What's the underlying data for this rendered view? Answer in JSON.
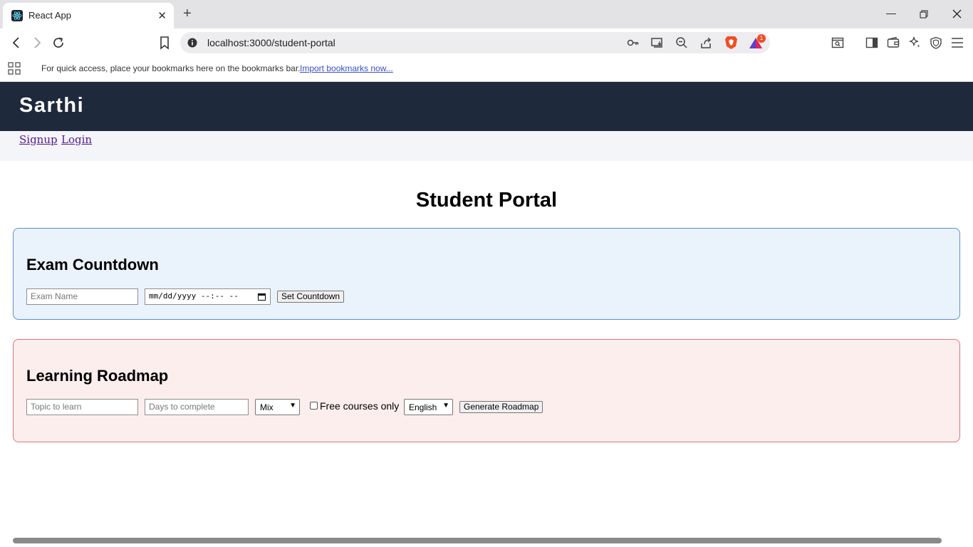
{
  "browser": {
    "tab_title": "React App",
    "tab_close": "✕",
    "new_tab": "+",
    "url": "localhost:3000/student-portal",
    "bookmarks_message": "For quick access, place your bookmarks here on the bookmarks bar.",
    "import_bookmarks": "Import bookmarks now...",
    "brave_badge": "1"
  },
  "header": {
    "brand": "Sarthi"
  },
  "nav": {
    "signup": "Signup",
    "login": "Login"
  },
  "page": {
    "title": "Student Portal"
  },
  "exam": {
    "heading": "Exam Countdown",
    "name_placeholder": "Exam Name",
    "datetime_value": "mm/dd/yyyy --:-- --",
    "button": "Set Countdown"
  },
  "roadmap": {
    "heading": "Learning Roadmap",
    "topic_placeholder": "Topic to learn",
    "days_placeholder": "Days to complete",
    "type_selected": "Mix",
    "free_label": "Free courses only",
    "language_selected": "English",
    "button": "Generate Roadmap"
  },
  "colors": {
    "header_bg": "#1e293b",
    "exam_bg": "#eaf2fb",
    "exam_border": "#5b8fd6",
    "roadmap_bg": "#fdeeee",
    "roadmap_border": "#e07272"
  }
}
